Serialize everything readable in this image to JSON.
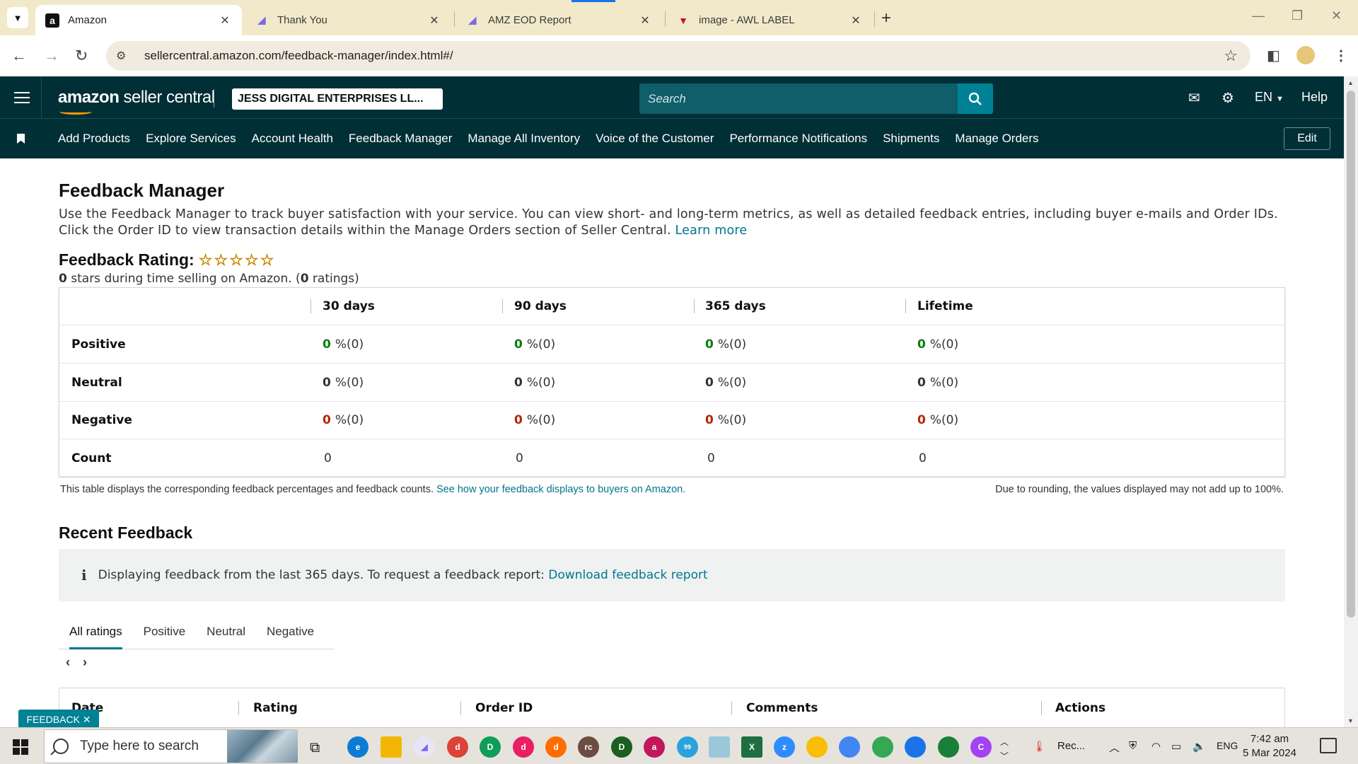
{
  "browser": {
    "tabs": [
      {
        "title": "Amazon",
        "icon": "amazon-favicon",
        "active": true
      },
      {
        "title": "Thank You",
        "icon": "clickup-favicon",
        "active": false
      },
      {
        "title": "AMZ EOD Report",
        "icon": "clickup-favicon",
        "active": false
      },
      {
        "title": "image - AWL LABEL",
        "icon": "vivaldi-favicon",
        "active": false
      }
    ],
    "url": "sellercentral.amazon.com/feedback-manager/index.html#/"
  },
  "header": {
    "logo_brand": "amazon",
    "logo_suffix": " seller central",
    "account": "JESS DIGITAL ENTERPRISES LL...",
    "search_placeholder": "Search",
    "language": "EN",
    "help": "Help",
    "nav": [
      "Add Products",
      "Explore Services",
      "Account Health",
      "Feedback Manager",
      "Manage All Inventory",
      "Voice of the Customer",
      "Performance Notifications",
      "Shipments",
      "Manage Orders"
    ],
    "edit": "Edit"
  },
  "page": {
    "title": "Feedback Manager",
    "intro": "Use the Feedback Manager to track buyer satisfaction with your service. You can view short- and long-term metrics, as well as detailed feedback entries, including buyer e-mails and Order IDs. Click the Order ID to view transaction details within the Manage Orders section of Seller Central.",
    "learn_more": "Learn more",
    "rating_label": "Feedback Rating:",
    "stars": "☆☆☆☆☆",
    "rating_stars": "0",
    "rating_sub_1": " stars during time selling on Amazon. (",
    "rating_count": "0",
    "rating_sub_2": " ratings)"
  },
  "feedback_table": {
    "columns": [
      "30 days",
      "90 days",
      "365 days",
      "Lifetime"
    ],
    "rows": [
      {
        "label": "Positive",
        "values": [
          "0",
          "0",
          "0",
          "0"
        ],
        "suffix": "%(0)"
      },
      {
        "label": "Neutral",
        "values": [
          "0",
          "0",
          "0",
          "0"
        ],
        "suffix": "%(0)"
      },
      {
        "label": "Negative",
        "values": [
          "0",
          "0",
          "0",
          "0"
        ],
        "suffix": "%(0)"
      },
      {
        "label": "Count",
        "values": [
          "0",
          "0",
          "0",
          "0"
        ]
      }
    ],
    "note": "This table displays the corresponding feedback percentages and feedback counts.",
    "note_link": "See how your feedback displays to buyers on Amazon.",
    "rounding_note": "Due to rounding, the values displayed may not add up to 100%."
  },
  "recent": {
    "title": "Recent Feedback",
    "info": "Displaying feedback from the last 365 days. To request a feedback report:",
    "info_link": "Download feedback report",
    "tabs": [
      "All ratings",
      "Positive",
      "Neutral",
      "Negative"
    ],
    "columns": [
      "Date",
      "Rating",
      "Order ID",
      "Comments",
      "Actions"
    ]
  },
  "feedback_tag": "FEEDBACK ✕",
  "taskbar": {
    "search_placeholder": "Type here to search",
    "weather": "Rec...",
    "language": "ENG",
    "time": "7:42 am",
    "date": "5 Mar 2024",
    "telegram_badge": "99"
  }
}
